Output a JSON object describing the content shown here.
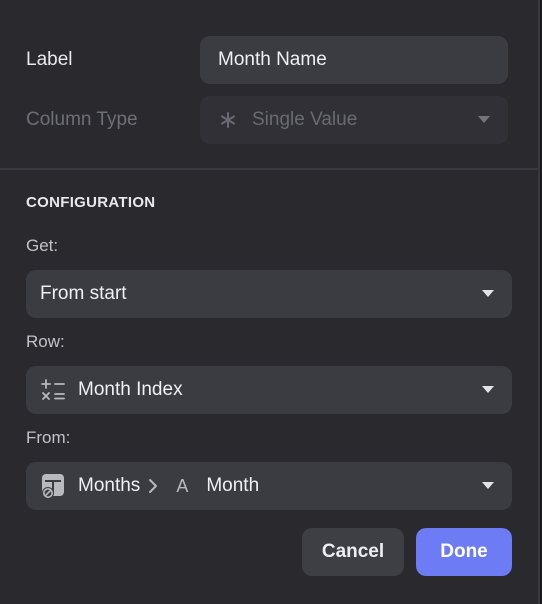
{
  "label_row": {
    "label": "Label",
    "value": "Month Name"
  },
  "column_type_row": {
    "label": "Column Type",
    "value": "Single Value",
    "icon": "asterisk-icon"
  },
  "configuration": {
    "heading": "CONFIGURATION",
    "get": {
      "label": "Get:",
      "value": "From start"
    },
    "row": {
      "label": "Row:",
      "value": "Month Index",
      "icon": "math-operators-icon"
    },
    "from": {
      "label": "From:",
      "table_icon": "table-link-icon",
      "table": "Months",
      "separator": ">",
      "column_icon": "text-column-icon",
      "column_icon_glyph": "A",
      "column": "Month"
    }
  },
  "buttons": {
    "cancel": "Cancel",
    "done": "Done"
  },
  "colors": {
    "background": "#29292e",
    "field": "#3b3b42",
    "accent": "#6d7cf5"
  }
}
